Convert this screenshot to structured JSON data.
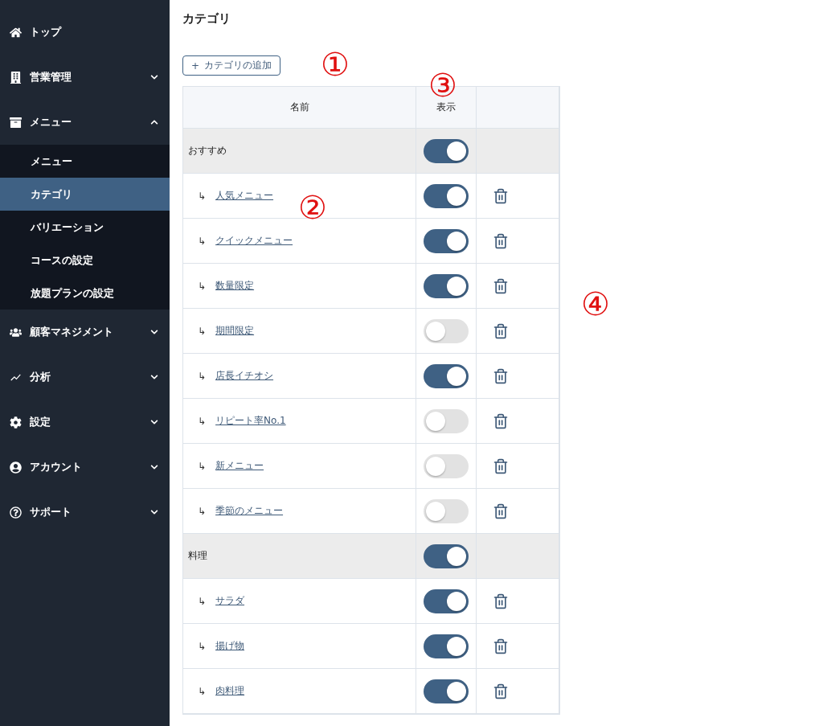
{
  "sidebar": {
    "items": [
      {
        "label": "トップ"
      },
      {
        "label": "営業管理",
        "expanded": false
      },
      {
        "label": "メニュー",
        "expanded": true,
        "children": [
          {
            "label": "メニュー",
            "selected": false
          },
          {
            "label": "カテゴリ",
            "selected": true
          },
          {
            "label": "バリエーション",
            "selected": false
          },
          {
            "label": "コースの設定",
            "selected": false
          },
          {
            "label": "放題プランの設定",
            "selected": false
          }
        ]
      },
      {
        "label": "顧客マネジメント",
        "expanded": false
      },
      {
        "label": "分析",
        "expanded": false
      },
      {
        "label": "設定",
        "expanded": false
      },
      {
        "label": "アカウント",
        "expanded": false
      },
      {
        "label": "サポート",
        "expanded": false
      }
    ]
  },
  "page_title": "カテゴリ",
  "add_button": {
    "icon": "+",
    "label": "カテゴリの追加"
  },
  "table": {
    "columns": [
      "名前",
      "表示"
    ],
    "rows": [
      {
        "kind": "group",
        "name": "おすすめ",
        "visible": true
      },
      {
        "kind": "child",
        "marker": "↳",
        "name": "人気メニュー",
        "visible": true
      },
      {
        "kind": "child",
        "marker": "↳",
        "name": "クイックメニュー",
        "visible": true
      },
      {
        "kind": "child",
        "marker": "↳",
        "name": "数量限定",
        "visible": true
      },
      {
        "kind": "child",
        "marker": "↳",
        "name": "期間限定",
        "visible": false
      },
      {
        "kind": "child",
        "marker": "↳",
        "name": "店長イチオシ",
        "visible": true
      },
      {
        "kind": "child",
        "marker": "↳",
        "name": "リピート率No.1",
        "visible": false
      },
      {
        "kind": "child",
        "marker": "↳",
        "name": "新メニュー",
        "visible": false
      },
      {
        "kind": "child",
        "marker": "↳",
        "name": "季節のメニュー",
        "visible": false
      },
      {
        "kind": "group",
        "name": "料理",
        "visible": true
      },
      {
        "kind": "child",
        "marker": "↳",
        "name": "サラダ",
        "visible": true
      },
      {
        "kind": "child",
        "marker": "↳",
        "name": "揚げ物",
        "visible": true
      },
      {
        "kind": "child",
        "marker": "↳",
        "name": "肉料理",
        "visible": true
      }
    ]
  },
  "annotations": [
    {
      "label": "①"
    },
    {
      "label": "②"
    },
    {
      "label": "③"
    },
    {
      "label": "④"
    }
  ]
}
